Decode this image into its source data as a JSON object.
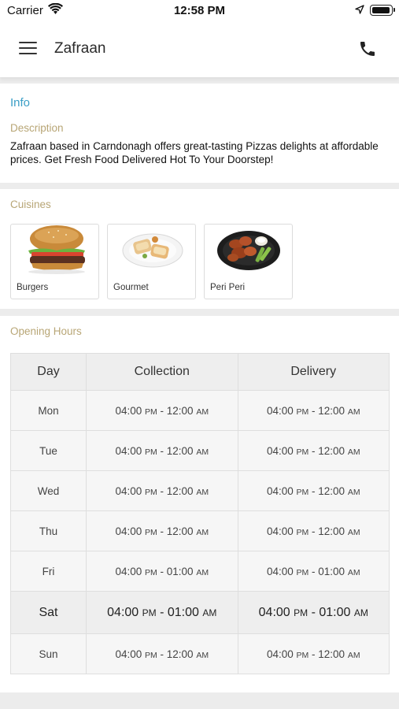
{
  "status_bar": {
    "carrier": "Carrier",
    "time": "12:58 PM"
  },
  "header": {
    "title": "Zafraan",
    "menu_icon": "hamburger-menu-icon",
    "call_icon": "phone-icon"
  },
  "info": {
    "title": "Info",
    "description_label": "Description",
    "description": "Zafraan based in Carndonagh offers great-tasting Pizzas delights at affordable prices. Get Fresh Food Delivered Hot To Your Doorstep!"
  },
  "cuisines": {
    "label": "Cuisines",
    "items": [
      {
        "name": "Burgers",
        "icon": "burger-image"
      },
      {
        "name": "Gourmet",
        "icon": "gourmet-plate-image"
      },
      {
        "name": "Peri Peri",
        "icon": "peri-peri-wings-image"
      }
    ]
  },
  "opening_hours": {
    "label": "Opening Hours",
    "columns": [
      "Day",
      "Collection",
      "Delivery"
    ],
    "rows": [
      {
        "day": "Mon",
        "collection": {
          "from": "04:00",
          "from_ampm": "PM",
          "to": "12:00",
          "to_ampm": "AM"
        },
        "delivery": {
          "from": "04:00",
          "from_ampm": "PM",
          "to": "12:00",
          "to_ampm": "AM"
        }
      },
      {
        "day": "Tue",
        "collection": {
          "from": "04:00",
          "from_ampm": "PM",
          "to": "12:00",
          "to_ampm": "AM"
        },
        "delivery": {
          "from": "04:00",
          "from_ampm": "PM",
          "to": "12:00",
          "to_ampm": "AM"
        }
      },
      {
        "day": "Wed",
        "collection": {
          "from": "04:00",
          "from_ampm": "PM",
          "to": "12:00",
          "to_ampm": "AM"
        },
        "delivery": {
          "from": "04:00",
          "from_ampm": "PM",
          "to": "12:00",
          "to_ampm": "AM"
        }
      },
      {
        "day": "Thu",
        "collection": {
          "from": "04:00",
          "from_ampm": "PM",
          "to": "12:00",
          "to_ampm": "AM"
        },
        "delivery": {
          "from": "04:00",
          "from_ampm": "PM",
          "to": "12:00",
          "to_ampm": "AM"
        }
      },
      {
        "day": "Fri",
        "collection": {
          "from": "04:00",
          "from_ampm": "PM",
          "to": "01:00",
          "to_ampm": "AM"
        },
        "delivery": {
          "from": "04:00",
          "from_ampm": "PM",
          "to": "01:00",
          "to_ampm": "AM"
        }
      },
      {
        "day": "Sat",
        "collection": {
          "from": "04:00",
          "from_ampm": "PM",
          "to": "01:00",
          "to_ampm": "AM"
        },
        "delivery": {
          "from": "04:00",
          "from_ampm": "PM",
          "to": "01:00",
          "to_ampm": "AM"
        }
      },
      {
        "day": "Sun",
        "collection": {
          "from": "04:00",
          "from_ampm": "PM",
          "to": "12:00",
          "to_ampm": "AM"
        },
        "delivery": {
          "from": "04:00",
          "from_ampm": "PM",
          "to": "12:00",
          "to_ampm": "AM"
        }
      }
    ]
  },
  "colors": {
    "accent": "#3a9ec6",
    "section_label": "#b8a676"
  }
}
